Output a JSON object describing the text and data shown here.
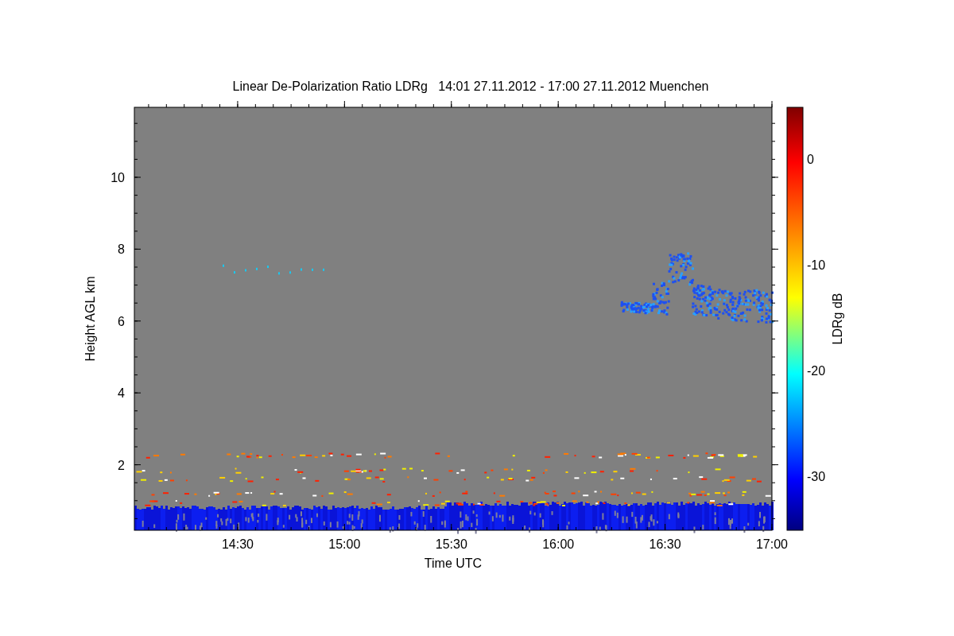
{
  "title": "Linear De-Polarization Ratio LDRg   14:01 27.11.2012 - 17:00 27.11.2012 Muenchen",
  "plot": {
    "xlabel": "Time UTC",
    "ylabel": "Height AGL km",
    "xticks": [
      "14:30",
      "15:00",
      "15:30",
      "16:00",
      "16:30",
      "17:00"
    ],
    "yticks": [
      "10",
      "8",
      "6",
      "4",
      "2"
    ]
  },
  "colorbar": {
    "label": "LDRg dB",
    "ticks": [
      "0",
      "-10",
      "-20",
      "-30"
    ]
  }
}
